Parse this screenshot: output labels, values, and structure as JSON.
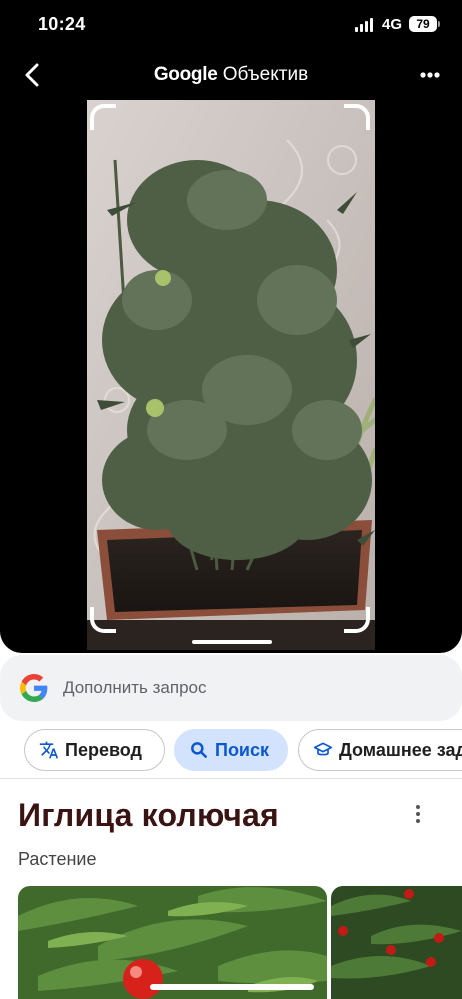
{
  "status_bar": {
    "time": "10:24",
    "network": "4G",
    "battery": "79"
  },
  "header": {
    "brand": "Google",
    "product": "Объектив",
    "back_icon": "chevron-left-icon",
    "menu_icon": "more-horizontal-icon"
  },
  "search": {
    "placeholder": "Дополнить запрос",
    "logo_icon": "google-g-icon"
  },
  "chips": [
    {
      "label": "Перевод",
      "icon": "translate-icon",
      "selected": false
    },
    {
      "label": "Поиск",
      "icon": "search-icon",
      "selected": true
    },
    {
      "label": "Домашнее задание",
      "icon": "graduation-cap-icon",
      "selected": false
    }
  ],
  "result": {
    "title": "Иглица колючая",
    "subtitle": "Растение",
    "menu_icon": "more-vertical-icon"
  },
  "colors": {
    "accent_chip_bg": "#d3e3fd",
    "accent_chip_text": "#0b57d0",
    "google_blue": "#4285F4",
    "google_red": "#EA4335",
    "google_yellow": "#FBBC05",
    "google_green": "#34A853",
    "title_color": "#3a1313"
  }
}
